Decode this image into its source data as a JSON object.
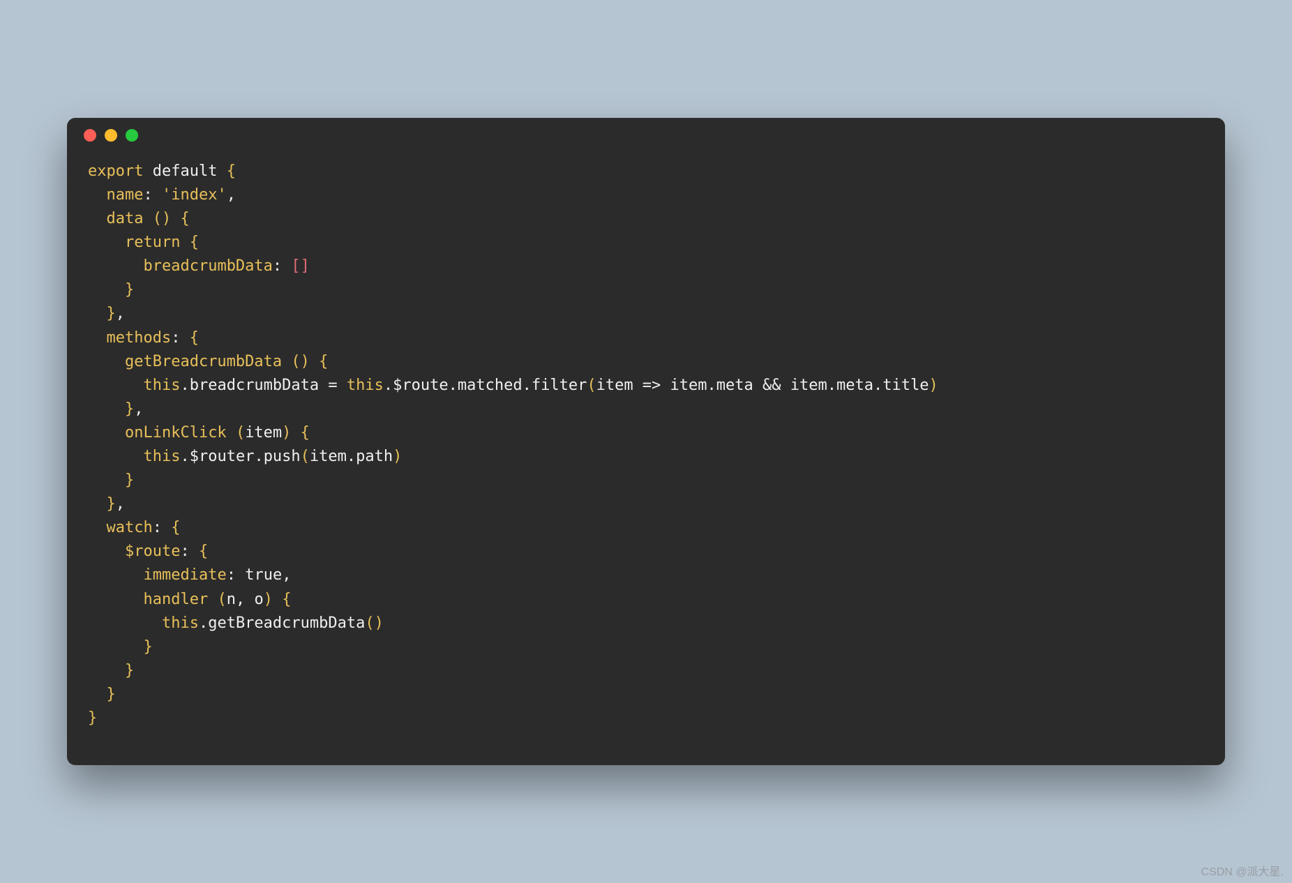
{
  "window": {
    "traffic_lights": [
      "red",
      "yellow",
      "green"
    ]
  },
  "code": {
    "tokens": [
      [
        {
          "t": "export",
          "c": "kw"
        },
        {
          "t": " ",
          "c": "def"
        },
        {
          "t": "default",
          "c": "def"
        },
        {
          "t": " ",
          "c": "def"
        },
        {
          "t": "{",
          "c": "brace"
        }
      ],
      [
        {
          "t": "  ",
          "c": "def"
        },
        {
          "t": "name",
          "c": "prop"
        },
        {
          "t": ":",
          "c": "punct"
        },
        {
          "t": " ",
          "c": "def"
        },
        {
          "t": "'index'",
          "c": "str"
        },
        {
          "t": ",",
          "c": "punct"
        }
      ],
      [
        {
          "t": "  ",
          "c": "def"
        },
        {
          "t": "data",
          "c": "prop"
        },
        {
          "t": " ",
          "c": "def"
        },
        {
          "t": "(",
          "c": "paren"
        },
        {
          "t": ")",
          "c": "paren"
        },
        {
          "t": " ",
          "c": "def"
        },
        {
          "t": "{",
          "c": "brace"
        }
      ],
      [
        {
          "t": "    ",
          "c": "def"
        },
        {
          "t": "return",
          "c": "kw"
        },
        {
          "t": " ",
          "c": "def"
        },
        {
          "t": "{",
          "c": "brace"
        }
      ],
      [
        {
          "t": "      ",
          "c": "def"
        },
        {
          "t": "breadcrumbData",
          "c": "prop"
        },
        {
          "t": ":",
          "c": "punct"
        },
        {
          "t": " ",
          "c": "def"
        },
        {
          "t": "[",
          "c": "bracket-red"
        },
        {
          "t": "]",
          "c": "bracket-red"
        }
      ],
      [
        {
          "t": "    ",
          "c": "def"
        },
        {
          "t": "}",
          "c": "brace"
        }
      ],
      [
        {
          "t": "  ",
          "c": "def"
        },
        {
          "t": "}",
          "c": "brace"
        },
        {
          "t": ",",
          "c": "punct"
        }
      ],
      [
        {
          "t": "  ",
          "c": "def"
        },
        {
          "t": "methods",
          "c": "prop"
        },
        {
          "t": ":",
          "c": "punct"
        },
        {
          "t": " ",
          "c": "def"
        },
        {
          "t": "{",
          "c": "brace"
        }
      ],
      [
        {
          "t": "    ",
          "c": "def"
        },
        {
          "t": "getBreadcrumbData",
          "c": "prop"
        },
        {
          "t": " ",
          "c": "def"
        },
        {
          "t": "(",
          "c": "paren"
        },
        {
          "t": ")",
          "c": "paren"
        },
        {
          "t": " ",
          "c": "def"
        },
        {
          "t": "{",
          "c": "brace"
        }
      ],
      [
        {
          "t": "      ",
          "c": "def"
        },
        {
          "t": "this",
          "c": "this"
        },
        {
          "t": ".",
          "c": "punct"
        },
        {
          "t": "breadcrumbData",
          "c": "ident"
        },
        {
          "t": " = ",
          "c": "op"
        },
        {
          "t": "this",
          "c": "this"
        },
        {
          "t": ".",
          "c": "punct"
        },
        {
          "t": "$route",
          "c": "ident"
        },
        {
          "t": ".",
          "c": "punct"
        },
        {
          "t": "matched",
          "c": "ident"
        },
        {
          "t": ".",
          "c": "punct"
        },
        {
          "t": "filter",
          "c": "ident"
        },
        {
          "t": "(",
          "c": "paren"
        },
        {
          "t": "item",
          "c": "ident"
        },
        {
          "t": " => ",
          "c": "op"
        },
        {
          "t": "item",
          "c": "ident"
        },
        {
          "t": ".",
          "c": "punct"
        },
        {
          "t": "meta",
          "c": "ident"
        },
        {
          "t": " && ",
          "c": "op"
        },
        {
          "t": "item",
          "c": "ident"
        },
        {
          "t": ".",
          "c": "punct"
        },
        {
          "t": "meta",
          "c": "ident"
        },
        {
          "t": ".",
          "c": "punct"
        },
        {
          "t": "title",
          "c": "ident"
        },
        {
          "t": ")",
          "c": "paren"
        }
      ],
      [
        {
          "t": "    ",
          "c": "def"
        },
        {
          "t": "}",
          "c": "brace"
        },
        {
          "t": ",",
          "c": "punct"
        }
      ],
      [
        {
          "t": "    ",
          "c": "def"
        },
        {
          "t": "onLinkClick",
          "c": "prop"
        },
        {
          "t": " ",
          "c": "def"
        },
        {
          "t": "(",
          "c": "paren"
        },
        {
          "t": "item",
          "c": "ident"
        },
        {
          "t": ")",
          "c": "paren"
        },
        {
          "t": " ",
          "c": "def"
        },
        {
          "t": "{",
          "c": "brace"
        }
      ],
      [
        {
          "t": "      ",
          "c": "def"
        },
        {
          "t": "this",
          "c": "this"
        },
        {
          "t": ".",
          "c": "punct"
        },
        {
          "t": "$router",
          "c": "ident"
        },
        {
          "t": ".",
          "c": "punct"
        },
        {
          "t": "push",
          "c": "ident"
        },
        {
          "t": "(",
          "c": "paren"
        },
        {
          "t": "item",
          "c": "ident"
        },
        {
          "t": ".",
          "c": "punct"
        },
        {
          "t": "path",
          "c": "ident"
        },
        {
          "t": ")",
          "c": "paren"
        }
      ],
      [
        {
          "t": "    ",
          "c": "def"
        },
        {
          "t": "}",
          "c": "brace"
        }
      ],
      [
        {
          "t": "  ",
          "c": "def"
        },
        {
          "t": "}",
          "c": "brace"
        },
        {
          "t": ",",
          "c": "punct"
        }
      ],
      [
        {
          "t": "  ",
          "c": "def"
        },
        {
          "t": "watch",
          "c": "prop"
        },
        {
          "t": ":",
          "c": "punct"
        },
        {
          "t": " ",
          "c": "def"
        },
        {
          "t": "{",
          "c": "brace"
        }
      ],
      [
        {
          "t": "    ",
          "c": "def"
        },
        {
          "t": "$route",
          "c": "prop"
        },
        {
          "t": ":",
          "c": "punct"
        },
        {
          "t": " ",
          "c": "def"
        },
        {
          "t": "{",
          "c": "brace"
        }
      ],
      [
        {
          "t": "      ",
          "c": "def"
        },
        {
          "t": "immediate",
          "c": "prop"
        },
        {
          "t": ":",
          "c": "punct"
        },
        {
          "t": " ",
          "c": "def"
        },
        {
          "t": "true",
          "c": "bool"
        },
        {
          "t": ",",
          "c": "punct"
        }
      ],
      [
        {
          "t": "      ",
          "c": "def"
        },
        {
          "t": "handler",
          "c": "prop"
        },
        {
          "t": " ",
          "c": "def"
        },
        {
          "t": "(",
          "c": "paren"
        },
        {
          "t": "n",
          "c": "ident"
        },
        {
          "t": ",",
          "c": "punct"
        },
        {
          "t": " ",
          "c": "def"
        },
        {
          "t": "o",
          "c": "ident"
        },
        {
          "t": ")",
          "c": "paren"
        },
        {
          "t": " ",
          "c": "def"
        },
        {
          "t": "{",
          "c": "brace"
        }
      ],
      [
        {
          "t": "        ",
          "c": "def"
        },
        {
          "t": "this",
          "c": "this"
        },
        {
          "t": ".",
          "c": "punct"
        },
        {
          "t": "getBreadcrumbData",
          "c": "ident"
        },
        {
          "t": "(",
          "c": "paren"
        },
        {
          "t": ")",
          "c": "paren"
        }
      ],
      [
        {
          "t": "      ",
          "c": "def"
        },
        {
          "t": "}",
          "c": "brace"
        }
      ],
      [
        {
          "t": "    ",
          "c": "def"
        },
        {
          "t": "}",
          "c": "brace"
        }
      ],
      [
        {
          "t": "  ",
          "c": "def"
        },
        {
          "t": "}",
          "c": "brace"
        }
      ],
      [
        {
          "t": "}",
          "c": "brace"
        }
      ]
    ]
  },
  "watermark": "CSDN @派大星."
}
